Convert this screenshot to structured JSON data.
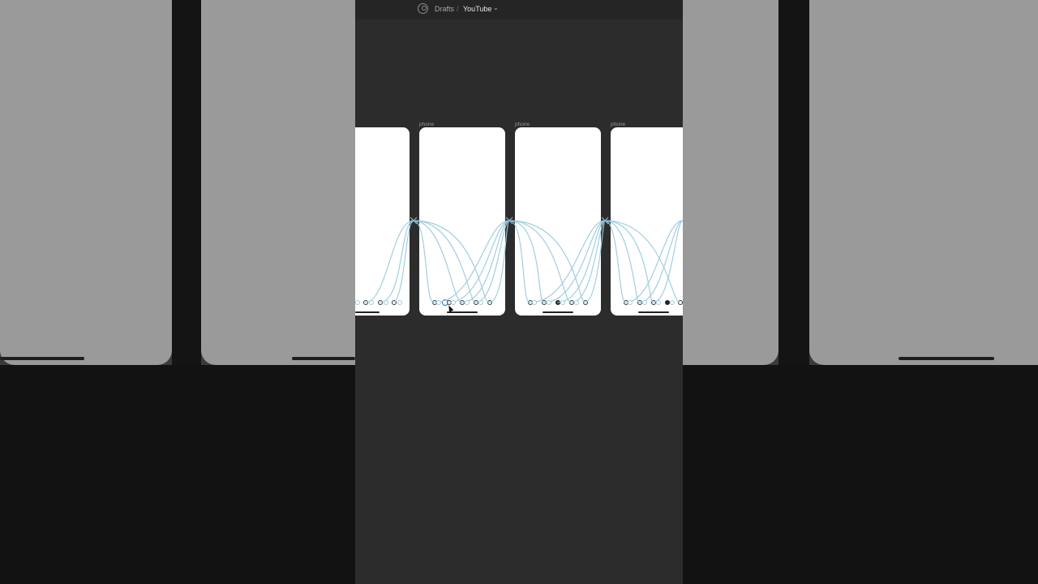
{
  "header": {
    "breadcrumb_root": "Drafts",
    "separator": "/",
    "file_name": "YouTube"
  },
  "frames": [
    {
      "label": ""
    },
    {
      "label": "phone"
    },
    {
      "label": "phone"
    },
    {
      "label": "phone"
    }
  ],
  "colors": {
    "canvas": "#2c2c2c",
    "topbar": "#252525",
    "prototype_wire": "#9ecbe0"
  },
  "icons": [
    "user-icon",
    "chevron-down-icon",
    "home-icon",
    "search-icon",
    "compass-icon",
    "profile-icon",
    "gear-icon",
    "add-icon",
    "cursor-icon"
  ]
}
